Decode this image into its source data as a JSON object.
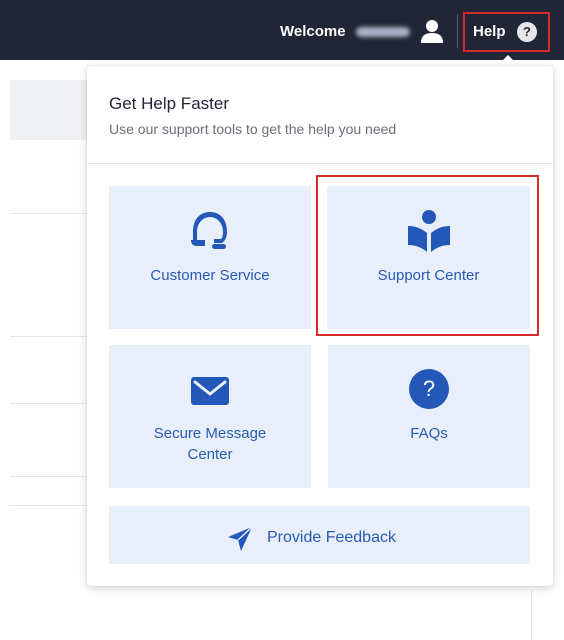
{
  "header": {
    "welcome_label": "Welcome",
    "username": "Martyn",
    "help_label": "Help",
    "help_icon_glyph": "?",
    "background_color": "#212636"
  },
  "dropdown": {
    "title": "Get Help Faster",
    "subtitle": "Use our support tools to get the help you need",
    "tiles": [
      {
        "label": "Customer Service",
        "icon": "headset-icon"
      },
      {
        "label": "Support Center",
        "icon": "reader-book-icon"
      },
      {
        "label": "Secure Message Center",
        "icon": "envelope-icon"
      },
      {
        "label": "FAQs",
        "icon": "question-circle-icon",
        "glyph": "?"
      }
    ],
    "feedback": {
      "label": "Provide Feedback",
      "icon": "paper-plane-icon"
    }
  },
  "colors": {
    "accent": "#2358b8",
    "tile_background": "#e8eefa",
    "highlight": "#d62b2b"
  }
}
